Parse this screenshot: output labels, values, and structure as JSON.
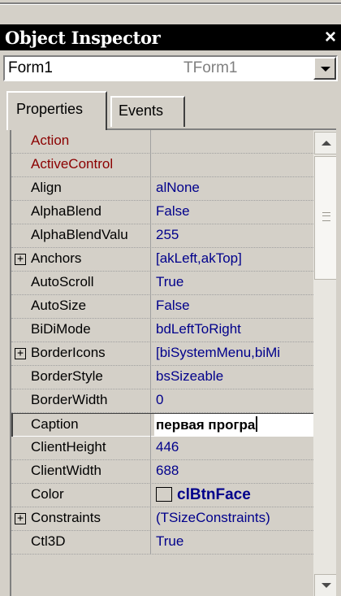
{
  "window": {
    "title": "Object Inspector",
    "close_glyph": "×"
  },
  "selector": {
    "name": "Form1",
    "type": "TForm1"
  },
  "tabs": [
    {
      "label": "Properties",
      "active": true
    },
    {
      "label": "Events",
      "active": false
    }
  ],
  "properties": [
    {
      "name": "Action",
      "value": "",
      "kind": "event"
    },
    {
      "name": "ActiveControl",
      "value": "",
      "kind": "event"
    },
    {
      "name": "Align",
      "value": "alNone"
    },
    {
      "name": "AlphaBlend",
      "value": "False"
    },
    {
      "name": "AlphaBlendValu",
      "value": "255"
    },
    {
      "name": "Anchors",
      "value": "[akLeft,akTop]",
      "expandable": true,
      "expander": "+"
    },
    {
      "name": "AutoScroll",
      "value": "True"
    },
    {
      "name": "AutoSize",
      "value": "False"
    },
    {
      "name": "BiDiMode",
      "value": "bdLeftToRight"
    },
    {
      "name": "BorderIcons",
      "value": "[biSystemMenu,biMi",
      "expandable": true,
      "expander": "+"
    },
    {
      "name": "BorderStyle",
      "value": "bsSizeable"
    },
    {
      "name": "BorderWidth",
      "value": "0"
    },
    {
      "name": "Caption",
      "value": "первая програ",
      "selected": true
    },
    {
      "name": "ClientHeight",
      "value": "446"
    },
    {
      "name": "ClientWidth",
      "value": "688"
    },
    {
      "name": "Color",
      "value": "clBtnFace",
      "swatch": "#d4d0c8"
    },
    {
      "name": "Constraints",
      "value": "(TSizeConstraints)",
      "expandable": true,
      "expander": "+"
    },
    {
      "name": "Ctl3D",
      "value": "True"
    }
  ],
  "scrollbar": {
    "up_icon": "scroll-up-icon",
    "down_icon": "scroll-down-icon",
    "thumb_fraction": 0.3
  },
  "colors": {
    "title_bg": "#000000",
    "event_text": "#8b0000",
    "value_text": "#00008b",
    "panel_bg": "#d4d0c8"
  }
}
